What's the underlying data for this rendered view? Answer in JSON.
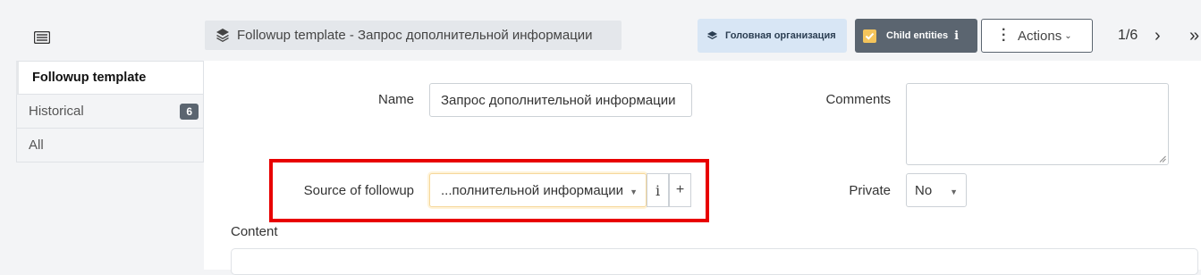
{
  "sidebar": {
    "tabs": [
      {
        "label": "Followup template",
        "active": true
      },
      {
        "label": "Historical",
        "badge": "6"
      },
      {
        "label": "All"
      }
    ]
  },
  "header": {
    "title": "Followup template - Запрос дополнительной информации",
    "org_label": "Головная организация",
    "child_entities_label": "Child entities",
    "child_entities_info": "i",
    "actions_label": "Actions",
    "pager": "1/6"
  },
  "form": {
    "name_label": "Name",
    "name_value": "Запрос дополнительной информации",
    "comments_label": "Comments",
    "comments_value": "",
    "source_label": "Source of followup",
    "source_value": "...полнительной информации",
    "source_info": "i",
    "source_add": "+",
    "private_label": "Private",
    "private_value": "No",
    "content_label": "Content"
  },
  "colors": {
    "highlight": "#e80000",
    "child_btn_bg": "#5b6570",
    "org_btn_bg": "#d8e6f5"
  }
}
